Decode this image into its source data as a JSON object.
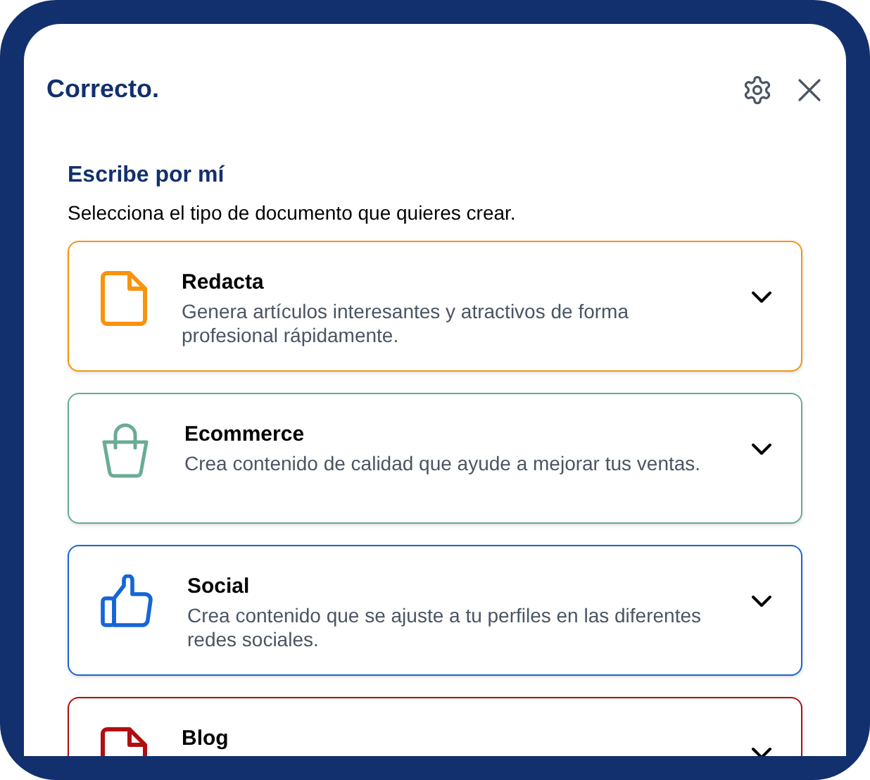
{
  "header": {
    "logo": "Correcto."
  },
  "section": {
    "title": "Escribe por mí",
    "subtitle": "Selecciona el tipo de documento que quieres crear."
  },
  "options": [
    {
      "kind": "document",
      "color": "#f7930f",
      "title": "Redacta",
      "description": "Genera artículos interesantes y atractivos de forma profesional rápidamente.",
      "expanded": false
    },
    {
      "kind": "bag",
      "color": "#6aab95",
      "title": "Ecommerce",
      "description": "Crea contenido de calidad que ayude a mejorar tus ventas.",
      "expanded": false
    },
    {
      "kind": "thumb",
      "color": "#1565d8",
      "title": "Social",
      "description": "Crea contenido que se ajuste a tu perfiles en las diferentes redes sociales.",
      "expanded": false
    },
    {
      "kind": "document",
      "color": "#b00e10",
      "title": "Blog",
      "expanded": false
    }
  ]
}
